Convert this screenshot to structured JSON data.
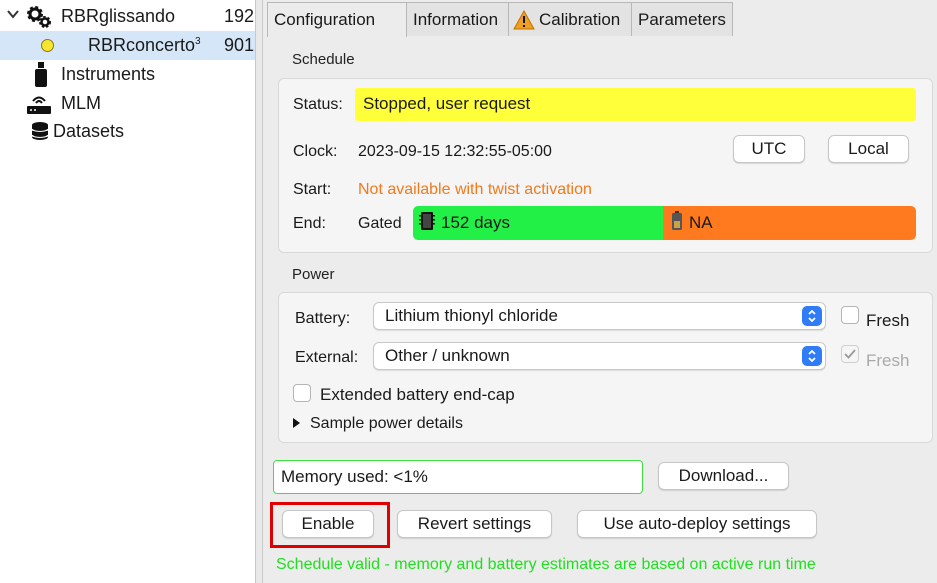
{
  "tree": {
    "items": [
      {
        "label": "RBRglissando",
        "value": "192"
      },
      {
        "label": "RBRconcerto",
        "superscript": "3",
        "value": "901."
      },
      {
        "label": "Instruments"
      },
      {
        "label": "MLM"
      },
      {
        "label": "Datasets"
      }
    ]
  },
  "tabs": [
    {
      "label": "Configuration",
      "active": true
    },
    {
      "label": "Information"
    },
    {
      "label": "Calibration",
      "icon": "warning-icon"
    },
    {
      "label": "Parameters"
    }
  ],
  "schedule": {
    "title": "Schedule",
    "status_label": "Status:",
    "status_value": "Stopped, user request",
    "clock_label": "Clock:",
    "clock_value": "2023-09-15 12:32:55-05:00",
    "utc_button": "UTC",
    "local_button": "Local",
    "start_label": "Start:",
    "start_value": "Not available with twist activation",
    "end_label": "End:",
    "end_mode": "Gated",
    "memory_days": "152  days",
    "battery_estimate": "NA"
  },
  "power": {
    "title": "Power",
    "battery_label": "Battery:",
    "battery_value": "Lithium thionyl chloride",
    "fresh_label": "Fresh",
    "external_label": "External:",
    "external_value": "Other / unknown",
    "external_fresh_label": "Fresh",
    "extended_label": "Extended battery end-cap",
    "sample_power_label": "Sample power details"
  },
  "memory": {
    "text": "Memory used: <1%"
  },
  "buttons": {
    "download": "Download...",
    "enable": "Enable",
    "revert": "Revert settings",
    "auto_deploy": "Use auto-deploy settings"
  },
  "validation_message": "Schedule valid - memory and battery estimates are based on active run time",
  "colors": {
    "status_bg": "#ffff3a",
    "memory_ok": "#22f046",
    "battery_na": "#ff7a1f",
    "warning_text": "#f07a1d",
    "valid_text": "#1ee01e",
    "highlight": "#e00000"
  }
}
